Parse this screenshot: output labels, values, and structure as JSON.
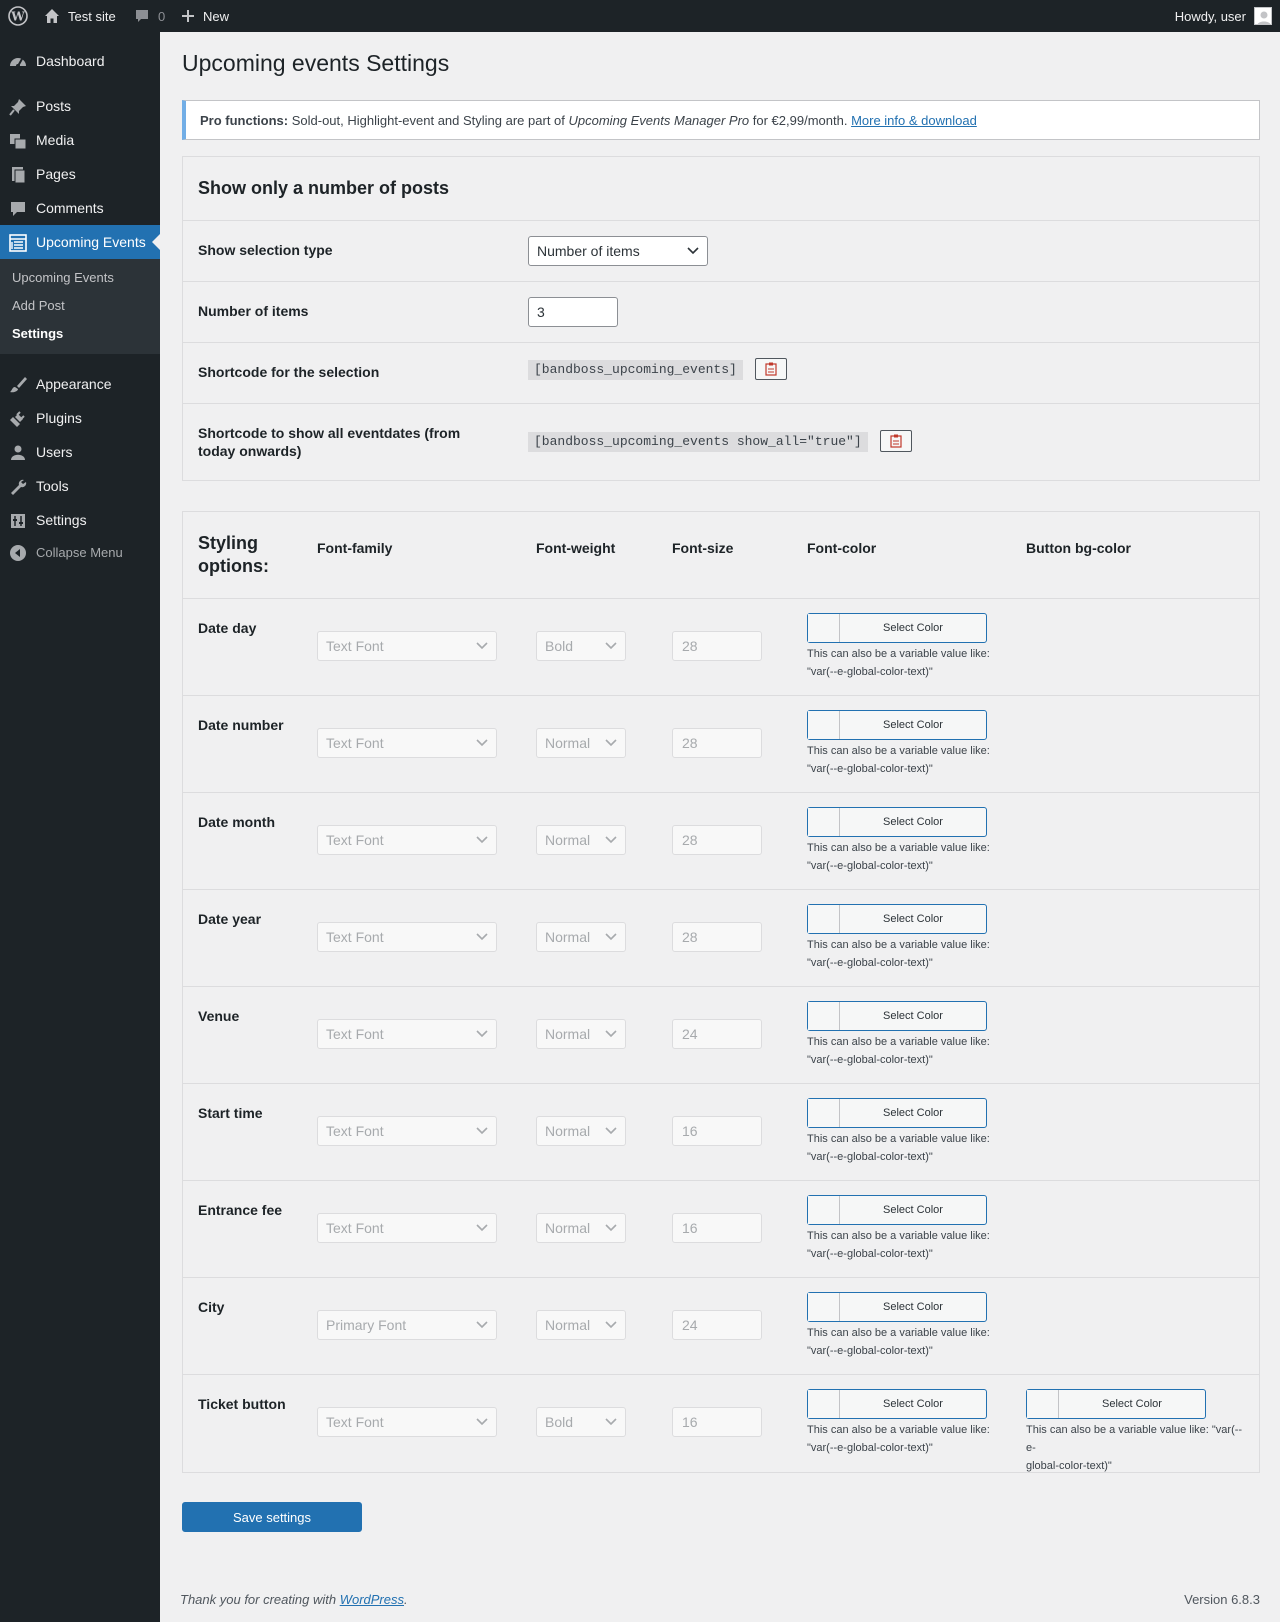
{
  "admin_bar": {
    "site_name": "Test site",
    "comments_count": "0",
    "new_label": "New",
    "howdy": "Howdy, user"
  },
  "sidebar": {
    "items": [
      {
        "label": "Dashboard",
        "icon": "dashboard-icon"
      },
      {
        "label": "Posts",
        "icon": "pushpin-icon"
      },
      {
        "label": "Media",
        "icon": "media-icon"
      },
      {
        "label": "Pages",
        "icon": "pages-icon"
      },
      {
        "label": "Comments",
        "icon": "comments-icon"
      },
      {
        "label": "Upcoming Events",
        "icon": "list-icon"
      },
      {
        "label": "Appearance",
        "icon": "paintbrush-icon"
      },
      {
        "label": "Plugins",
        "icon": "plugin-icon"
      },
      {
        "label": "Users",
        "icon": "users-icon"
      },
      {
        "label": "Tools",
        "icon": "wrench-icon"
      },
      {
        "label": "Settings",
        "icon": "settings-icon"
      },
      {
        "label": "Collapse Menu",
        "icon": "collapse-icon"
      }
    ],
    "submenu": [
      "Upcoming Events",
      "Add Post",
      "Settings"
    ]
  },
  "page": {
    "title": "Upcoming events Settings",
    "notice": {
      "bold": "Pro functions:",
      "text": " Sold-out, Highlight-event and Styling are part of ",
      "product": "Upcoming Events Manager Pro",
      "price": " for €2,99/month. ",
      "link": "More info & download"
    }
  },
  "posts_section": {
    "heading": "Show only a number of posts",
    "selection_type_label": "Show selection type",
    "selection_type_value": "Number of items",
    "number_label": "Number of items",
    "number_value": "3",
    "shortcode_label": "Shortcode for the selection",
    "shortcode_value": "[bandboss_upcoming_events]",
    "shortcode_all_label": "Shortcode to show all eventdates (from today onwards)",
    "shortcode_all_value": "[bandboss_upcoming_events show_all=\"true\"]"
  },
  "styling": {
    "heading": "Styling options:",
    "columns": [
      "Font-family",
      "Font-weight",
      "Font-size",
      "Font-color",
      "Button bg-color"
    ],
    "select_color_label": "Select Color",
    "hint_line1": "This can also be a variable value like:",
    "hint_line2": "\"var(--e-global-color-text)\"",
    "bg_hint_line1": "This can also be a variable value like: \"var(--e-",
    "bg_hint_line2": "global-color-text)\"",
    "rows": [
      {
        "label": "Date day",
        "family": "Text Font",
        "weight": "Bold",
        "size": "28"
      },
      {
        "label": "Date number",
        "family": "Text Font",
        "weight": "Normal",
        "size": "28"
      },
      {
        "label": "Date month",
        "family": "Text Font",
        "weight": "Normal",
        "size": "28"
      },
      {
        "label": "Date year",
        "family": "Text Font",
        "weight": "Normal",
        "size": "28"
      },
      {
        "label": "Venue",
        "family": "Text Font",
        "weight": "Normal",
        "size": "24"
      },
      {
        "label": "Start time",
        "family": "Text Font",
        "weight": "Normal",
        "size": "16"
      },
      {
        "label": "Entrance fee",
        "family": "Text Font",
        "weight": "Normal",
        "size": "16"
      },
      {
        "label": "City",
        "family": "Primary Font",
        "weight": "Normal",
        "size": "24"
      },
      {
        "label": "Ticket button",
        "family": "Text Font",
        "weight": "Bold",
        "size": "16"
      }
    ]
  },
  "save_label": "Save settings",
  "footer": {
    "thanks": "Thank you for creating with ",
    "link": "WordPress",
    "period": ".",
    "version": "Version 6.8.3"
  },
  "colors": {
    "admin_bar": "#1d2327",
    "accent": "#2271b1",
    "background": "#f0f0f1"
  }
}
